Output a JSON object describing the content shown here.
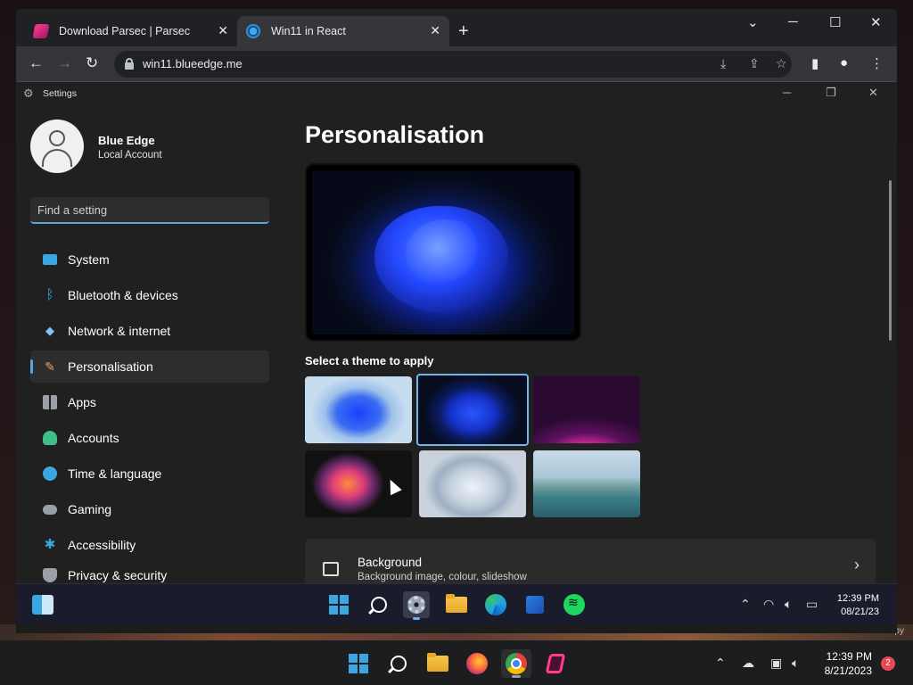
{
  "browser": {
    "tabs": [
      {
        "title": "Download Parsec | Parsec",
        "favicon": "parsec-icon"
      },
      {
        "title": "Win11 in React",
        "favicon": "win11-icon",
        "active": true
      }
    ],
    "url": "win11.blueedge.me",
    "controls": {
      "minimize": "─",
      "maximize": "☐",
      "close": "✕",
      "tab_search": "⌄",
      "new_tab": "+"
    }
  },
  "settings": {
    "window_title": "Settings",
    "profile": {
      "name": "Blue Edge",
      "account_type": "Local Account"
    },
    "search": {
      "placeholder": "Find a setting"
    },
    "nav": [
      {
        "label": "System",
        "icon": "system-icon"
      },
      {
        "label": "Bluetooth & devices",
        "icon": "bluetooth-icon"
      },
      {
        "label": "Network & internet",
        "icon": "network-icon"
      },
      {
        "label": "Personalisation",
        "icon": "brush-icon",
        "active": true
      },
      {
        "label": "Apps",
        "icon": "apps-icon"
      },
      {
        "label": "Accounts",
        "icon": "accounts-icon"
      },
      {
        "label": "Time & language",
        "icon": "globe-icon"
      },
      {
        "label": "Gaming",
        "icon": "gamepad-icon"
      },
      {
        "label": "Accessibility",
        "icon": "accessibility-icon"
      },
      {
        "label": "Privacy & security",
        "icon": "shield-icon"
      }
    ],
    "page_title": "Personalisation",
    "themes_label": "Select a theme to apply",
    "selected_theme_index": 1,
    "background_card": {
      "title": "Background",
      "subtitle": "Background image, colour, slideshow"
    }
  },
  "w11_taskbar": {
    "time": "12:39 PM",
    "date": "08/21/23"
  },
  "host_taskbar": {
    "time": "12:39 PM",
    "date": "8/21/2023",
    "notifications": "2"
  },
  "host_strip_text": "Evaluation copy"
}
